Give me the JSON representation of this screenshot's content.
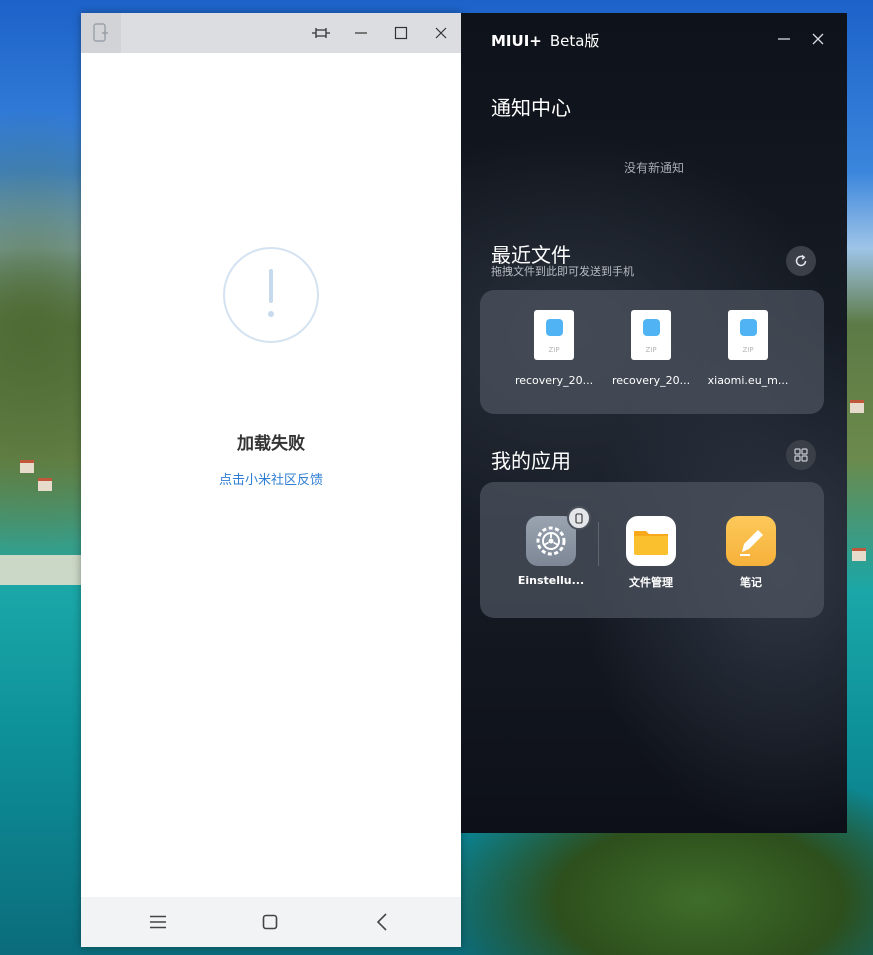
{
  "phone": {
    "error_title": "加载失败",
    "error_link": "点击小米社区反馈"
  },
  "miui": {
    "brand": "MIUI+",
    "beta": "Beta版",
    "notifications": {
      "title": "通知中心",
      "empty": "没有新通知"
    },
    "files": {
      "title": "最近文件",
      "subtitle": "拖拽文件到此即可发送到手机",
      "items": [
        {
          "name": "recovery_20...",
          "ext": "ZIP"
        },
        {
          "name": "recovery_20...",
          "ext": "ZIP"
        },
        {
          "name": "xiaomi.eu_m...",
          "ext": "ZIP"
        }
      ]
    },
    "apps": {
      "title": "我的应用",
      "items": [
        {
          "name": "Einstellu...",
          "icon": "settings-gear-icon"
        },
        {
          "name": "文件管理",
          "icon": "file-manager-folder-icon"
        },
        {
          "name": "笔记",
          "icon": "notes-pencil-icon"
        }
      ]
    }
  }
}
